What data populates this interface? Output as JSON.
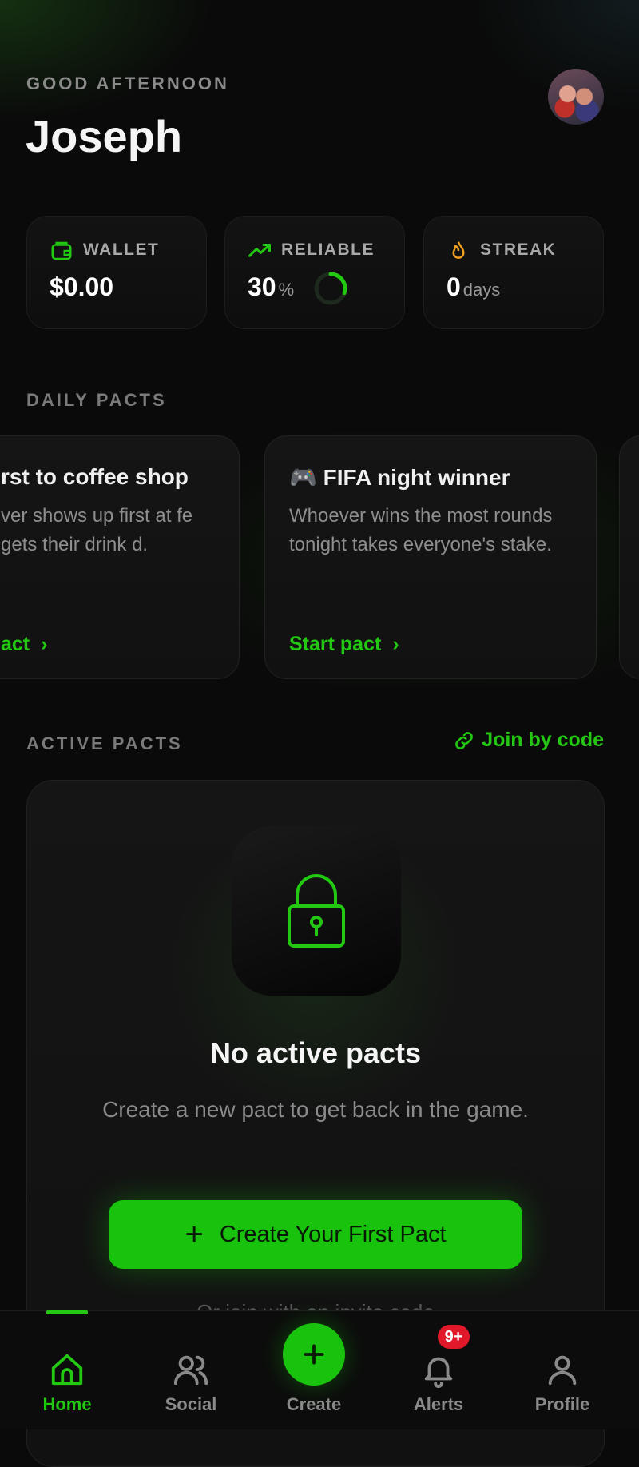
{
  "header": {
    "greeting": "GOOD AFTERNOON",
    "user_name": "Joseph"
  },
  "stats": {
    "wallet": {
      "label": "WALLET",
      "value": "$0.00",
      "icon": "wallet-icon"
    },
    "reliable": {
      "label": "RELIABLE",
      "value": "30",
      "unit": "%",
      "progress_fraction": 0.3,
      "icon": "trending-up-icon"
    },
    "streak": {
      "label": "STREAK",
      "value": "0",
      "unit": "days",
      "icon": "flame-icon"
    }
  },
  "daily_pacts": {
    "section_label": "DAILY PACTS",
    "cards": [
      {
        "title": "rst to coffee shop",
        "description": "ver shows up first at fe gets their drink d.",
        "action": "act"
      },
      {
        "title": "🎮 FIFA night winner",
        "description": "Whoever wins the most rounds tonight takes everyone's stake.",
        "action": "Start pact"
      }
    ]
  },
  "active_pacts": {
    "section_label": "ACTIVE PACTS",
    "join_label": "Join by code",
    "empty_title": "No active pacts",
    "empty_subtitle": "Create a new pact to get back in the game.",
    "cta_label": "Create Your First Pact",
    "invite_text": "Or join with an invite code"
  },
  "tabbar": {
    "items": [
      {
        "label": "Home",
        "icon": "home-icon",
        "active": true
      },
      {
        "label": "Social",
        "icon": "users-icon",
        "active": false
      },
      {
        "label": "Create",
        "icon": "plus-icon",
        "active": false
      },
      {
        "label": "Alerts",
        "icon": "bell-icon",
        "active": false,
        "badge": "9+"
      },
      {
        "label": "Profile",
        "icon": "user-icon",
        "active": false
      }
    ]
  },
  "colors": {
    "accent": "#22c812",
    "button": "#18c20d",
    "badge": "#e0182a",
    "streak_icon": "#f0a020"
  }
}
